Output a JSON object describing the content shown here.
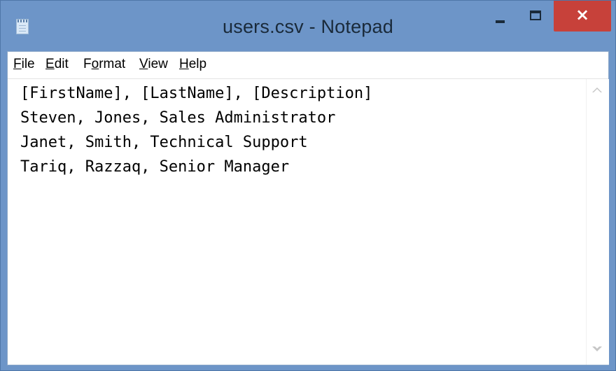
{
  "window": {
    "title": "users.csv - Notepad",
    "app_icon": "notepad-icon",
    "controls": {
      "minimize_icon": "minimize-icon",
      "maximize_icon": "maximize-icon",
      "close_icon": "close-icon",
      "close_glyph": "×"
    },
    "colors": {
      "titlebar": "#6d95c8",
      "close_button": "#c7413a"
    }
  },
  "menu": {
    "items": [
      {
        "label": "File",
        "accel": "F",
        "rest": "ile"
      },
      {
        "label": "Edit",
        "accel": "E",
        "rest": "dit"
      },
      {
        "label": "Format",
        "pre": "F",
        "accel": "o",
        "rest": "rmat"
      },
      {
        "label": "View",
        "accel": "V",
        "rest": "iew"
      },
      {
        "label": "Help",
        "accel": "H",
        "rest": "elp"
      }
    ]
  },
  "editor": {
    "lines": [
      "[FirstName], [LastName], [Description]",
      "Steven, Jones, Sales Administrator",
      "Janet, Smith, Technical Support",
      "Tariq, Razzaq, Senior Manager"
    ]
  }
}
